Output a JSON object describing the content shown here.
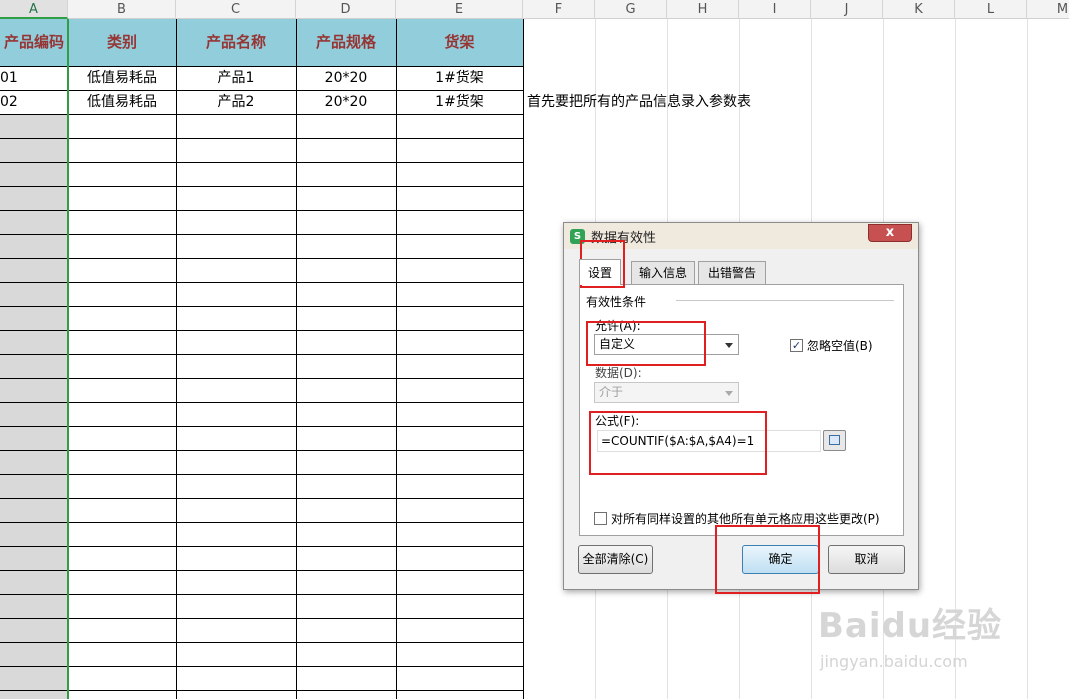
{
  "columns": [
    "A",
    "B",
    "C",
    "D",
    "E",
    "F",
    "G",
    "H",
    "I",
    "J",
    "K",
    "L",
    "M"
  ],
  "table": {
    "headers": [
      "产品编码",
      "类别",
      "产品名称",
      "产品规格",
      "货架"
    ],
    "rows": [
      [
        "01",
        "低值易耗品",
        "产品1",
        "20*20",
        "1#货架"
      ],
      [
        "02",
        "低值易耗品",
        "产品2",
        "20*20",
        "1#货架"
      ]
    ]
  },
  "note": "首先要把所有的产品信息录入参数表",
  "dialog": {
    "title": "数据有效性",
    "close_label": "x",
    "app_icon_label": "S",
    "tabs": [
      "设置",
      "输入信息",
      "出错警告"
    ],
    "section_label": "有效性条件",
    "allow_label": "允许(A):",
    "allow_value": "自定义",
    "ignore_blank_label": "忽略空值(B)",
    "ignore_blank_checked": true,
    "data_label": "数据(D):",
    "data_value": "介于",
    "formula_label": "公式(F):",
    "formula_value": "=COUNTIF($A:$A,$A4)=1",
    "apply_all_label": "对所有同样设置的其他所有单元格应用这些更改(P)",
    "clear_all_label": "全部清除(C)",
    "ok_label": "确定",
    "cancel_label": "取消"
  },
  "watermark": {
    "logo": "Baidu经验",
    "url": "jingyan.baidu.com"
  },
  "colors": {
    "header_fill": "#92cddc",
    "header_text": "#963634",
    "highlight": "#e02020",
    "selected_col": "#2f9e44"
  },
  "icons": [
    "app-icon",
    "close-icon",
    "dropdown-arrow-icon",
    "checkbox-icon",
    "range-select-icon"
  ]
}
